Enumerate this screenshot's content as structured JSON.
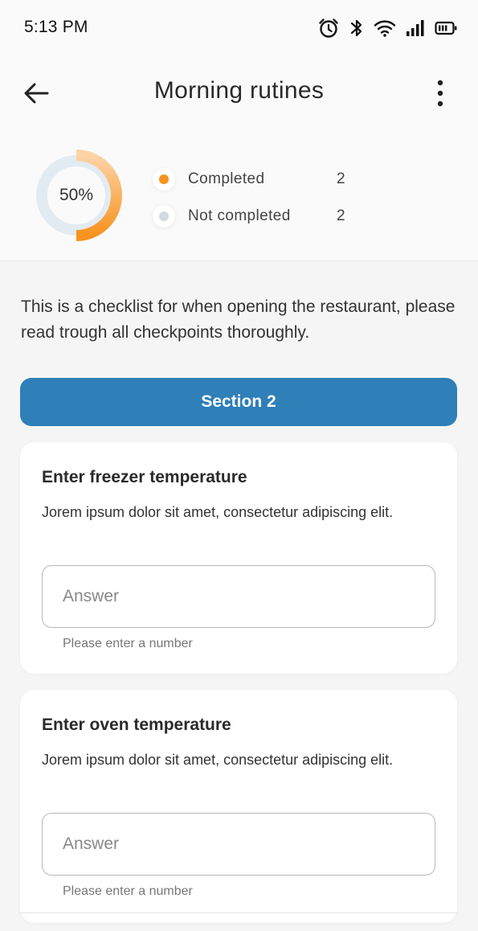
{
  "status_bar": {
    "time": "5:13 PM",
    "icons": [
      "alarm-icon",
      "bluetooth-icon",
      "wifi-icon",
      "signal-icon",
      "battery-icon"
    ]
  },
  "app_bar": {
    "title": "Morning rutines",
    "back_icon": "arrow-left-icon",
    "menu_icon": "more-vertical-icon"
  },
  "progress": {
    "percent_label": "50%",
    "fraction_completed": 0.5,
    "legend": [
      {
        "label": "Completed",
        "count": "2",
        "color": "#f7931e"
      },
      {
        "label": "Not completed",
        "count": "2",
        "color": "#d5d9dd"
      }
    ]
  },
  "description": "This is a checklist for when opening the restaurant, please read trough all checkpoints thoroughly.",
  "section": {
    "label": "Section 2",
    "color": "#2f7fb8"
  },
  "cards": [
    {
      "title": "Enter freezer temperature",
      "description": "Jorem ipsum dolor sit amet, consectetur adipiscing elit.",
      "placeholder": "Answer",
      "helper": "Please enter a number"
    },
    {
      "title": "Enter oven temperature",
      "description": "Jorem ipsum dolor sit amet, consectetur adipiscing elit.",
      "placeholder": "Answer",
      "helper": "Please enter a number"
    }
  ]
}
